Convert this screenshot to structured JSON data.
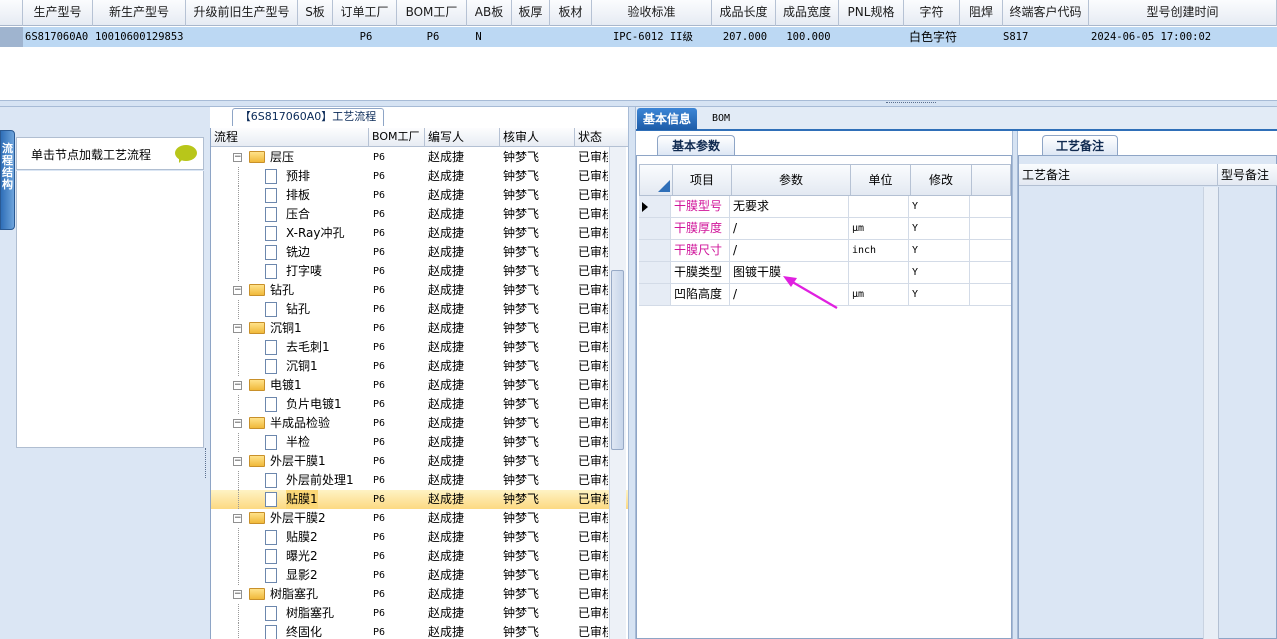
{
  "top_grid": {
    "headers": [
      "生产型号",
      "新生产型号",
      "升级前旧生产型号",
      "S板",
      "订单工厂",
      "BOM工厂",
      "AB板",
      "板厚",
      "板材",
      "验收标准",
      "成品长度",
      "成品宽度",
      "PNL规格",
      "字符",
      "阻焊",
      "终端客户代码",
      "型号创建时间"
    ],
    "row": [
      "6S817060A0",
      "10010600129853",
      "",
      "",
      "P6",
      "P6",
      "N",
      "",
      "",
      "IPC-6012 II级",
      "207.000",
      "100.000",
      "",
      "白色字符",
      "",
      "S817",
      "2024-06-05 17:00:02"
    ]
  },
  "flow_tab_label": "【6S817060A0】工艺流程",
  "side_tab_label": "流程结构",
  "notice_text": "单击节点加载工艺流程",
  "tree": {
    "headers": [
      "流程",
      "BOM工厂",
      "编写人",
      "核审人",
      "状态"
    ],
    "rows": [
      {
        "name": "层压",
        "level": 0,
        "folder": true,
        "bom": "P6",
        "writer": "赵成捷",
        "reviewer": "钟梦飞",
        "status": "已审核"
      },
      {
        "name": "预排",
        "level": 1,
        "folder": false,
        "bom": "P6",
        "writer": "赵成捷",
        "reviewer": "钟梦飞",
        "status": "已审核"
      },
      {
        "name": "排板",
        "level": 1,
        "folder": false,
        "bom": "P6",
        "writer": "赵成捷",
        "reviewer": "钟梦飞",
        "status": "已审核"
      },
      {
        "name": "压合",
        "level": 1,
        "folder": false,
        "bom": "P6",
        "writer": "赵成捷",
        "reviewer": "钟梦飞",
        "status": "已审核"
      },
      {
        "name": "X-Ray冲孔",
        "level": 1,
        "folder": false,
        "bom": "P6",
        "writer": "赵成捷",
        "reviewer": "钟梦飞",
        "status": "已审核"
      },
      {
        "name": "铣边",
        "level": 1,
        "folder": false,
        "bom": "P6",
        "writer": "赵成捷",
        "reviewer": "钟梦飞",
        "status": "已审核"
      },
      {
        "name": "打字唛",
        "level": 1,
        "folder": false,
        "bom": "P6",
        "writer": "赵成捷",
        "reviewer": "钟梦飞",
        "status": "已审核"
      },
      {
        "name": "钻孔",
        "level": 0,
        "folder": true,
        "bom": "P6",
        "writer": "赵成捷",
        "reviewer": "钟梦飞",
        "status": "已审核"
      },
      {
        "name": "钻孔",
        "level": 1,
        "folder": false,
        "bom": "P6",
        "writer": "赵成捷",
        "reviewer": "钟梦飞",
        "status": "已审核"
      },
      {
        "name": "沉铜1",
        "level": 0,
        "folder": true,
        "bom": "P6",
        "writer": "赵成捷",
        "reviewer": "钟梦飞",
        "status": "已审核"
      },
      {
        "name": "去毛刺1",
        "level": 1,
        "folder": false,
        "bom": "P6",
        "writer": "赵成捷",
        "reviewer": "钟梦飞",
        "status": "已审核"
      },
      {
        "name": "沉铜1",
        "level": 1,
        "folder": false,
        "bom": "P6",
        "writer": "赵成捷",
        "reviewer": "钟梦飞",
        "status": "已审核"
      },
      {
        "name": "电镀1",
        "level": 0,
        "folder": true,
        "bom": "P6",
        "writer": "赵成捷",
        "reviewer": "钟梦飞",
        "status": "已审核"
      },
      {
        "name": "负片电镀1",
        "level": 1,
        "folder": false,
        "bom": "P6",
        "writer": "赵成捷",
        "reviewer": "钟梦飞",
        "status": "已审核"
      },
      {
        "name": "半成品检验",
        "level": 0,
        "folder": true,
        "bom": "P6",
        "writer": "赵成捷",
        "reviewer": "钟梦飞",
        "status": "已审核"
      },
      {
        "name": "半检",
        "level": 1,
        "folder": false,
        "bom": "P6",
        "writer": "赵成捷",
        "reviewer": "钟梦飞",
        "status": "已审核"
      },
      {
        "name": "外层干膜1",
        "level": 0,
        "folder": true,
        "bom": "P6",
        "writer": "赵成捷",
        "reviewer": "钟梦飞",
        "status": "已审核"
      },
      {
        "name": "外层前处理1",
        "level": 1,
        "folder": false,
        "bom": "P6",
        "writer": "赵成捷",
        "reviewer": "钟梦飞",
        "status": "已审核"
      },
      {
        "name": "贴膜1",
        "level": 1,
        "folder": false,
        "bom": "P6",
        "writer": "赵成捷",
        "reviewer": "钟梦飞",
        "status": "已审核",
        "selected": true
      },
      {
        "name": "外层干膜2",
        "level": 0,
        "folder": true,
        "bom": "P6",
        "writer": "赵成捷",
        "reviewer": "钟梦飞",
        "status": "已审核"
      },
      {
        "name": "贴膜2",
        "level": 1,
        "folder": false,
        "bom": "P6",
        "writer": "赵成捷",
        "reviewer": "钟梦飞",
        "status": "已审核"
      },
      {
        "name": "曝光2",
        "level": 1,
        "folder": false,
        "bom": "P6",
        "writer": "赵成捷",
        "reviewer": "钟梦飞",
        "status": "已审核"
      },
      {
        "name": "显影2",
        "level": 1,
        "folder": false,
        "bom": "P6",
        "writer": "赵成捷",
        "reviewer": "钟梦飞",
        "status": "已审核"
      },
      {
        "name": "树脂塞孔",
        "level": 0,
        "folder": true,
        "bom": "P6",
        "writer": "赵成捷",
        "reviewer": "钟梦飞",
        "status": "已审核"
      },
      {
        "name": "树脂塞孔",
        "level": 1,
        "folder": false,
        "bom": "P6",
        "writer": "赵成捷",
        "reviewer": "钟梦飞",
        "status": "已审核"
      },
      {
        "name": "终固化",
        "level": 1,
        "folder": false,
        "bom": "P6",
        "writer": "赵成捷",
        "reviewer": "钟梦飞",
        "status": "已审核"
      }
    ]
  },
  "right_tabs": {
    "basic_info": "基本信息",
    "bom": "BOM"
  },
  "basic_params_tab": "基本参数",
  "param_grid": {
    "headers": {
      "item": "项目",
      "param": "参数",
      "unit": "单位",
      "modify": "修改"
    },
    "rows": [
      {
        "item": "干膜型号",
        "value": "无要求",
        "unit": "",
        "modify": "Y",
        "pink": true,
        "current": true
      },
      {
        "item": "干膜厚度",
        "value": "/",
        "unit": "μm",
        "modify": "Y",
        "pink": true
      },
      {
        "item": "干膜尺寸",
        "value": "/",
        "unit": "inch",
        "modify": "Y",
        "pink": true
      },
      {
        "item": "干膜类型",
        "value": "图镀干膜",
        "unit": "",
        "modify": "Y",
        "pink": false
      },
      {
        "item": "凹陷高度",
        "value": "/",
        "unit": "μm",
        "modify": "Y",
        "pink": false
      }
    ]
  },
  "notes_tab": "工艺备注",
  "notes_grid": {
    "col1": "工艺备注",
    "col2": "型号备注"
  },
  "colors": {
    "selection": "#bcd8f3",
    "accent": "#2f6fb8",
    "pink": "#d0149a",
    "arrow": "#e020e0"
  }
}
